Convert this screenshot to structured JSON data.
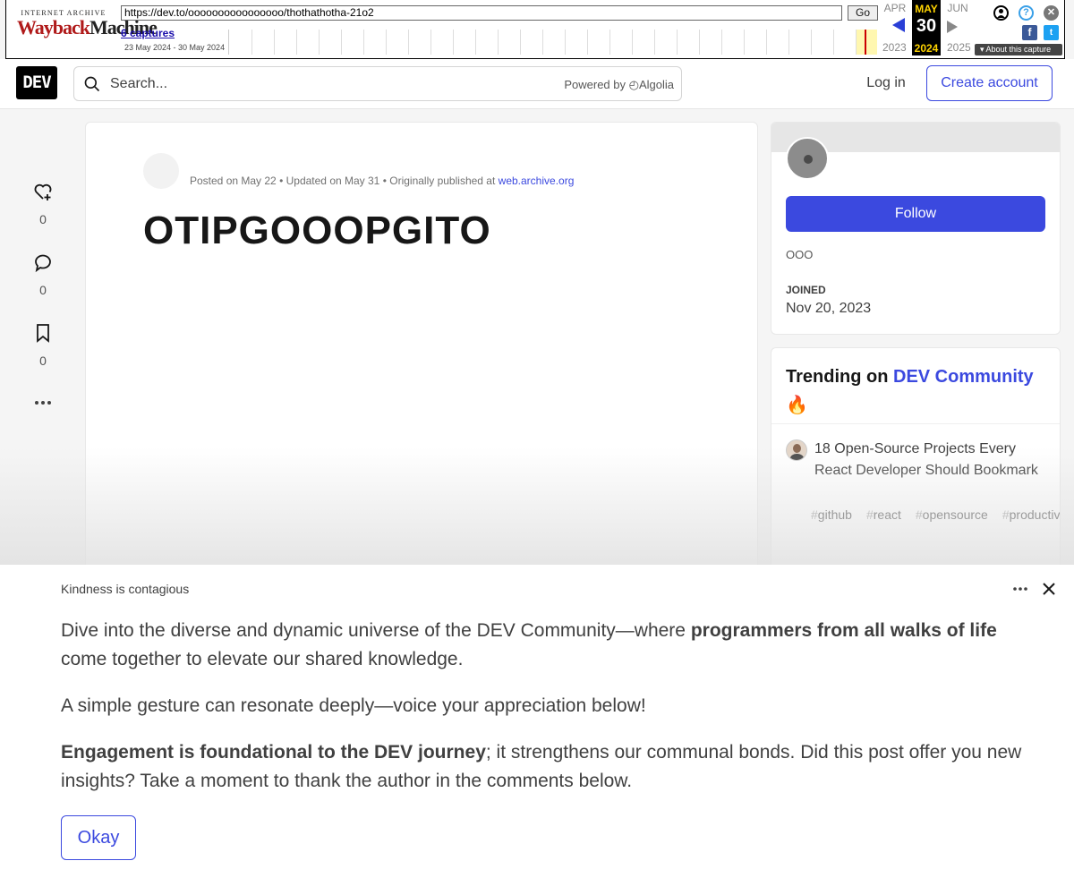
{
  "wayback": {
    "logo_top": "INTERNET ARCHIVE",
    "logo_wayback": "WaybackMachine",
    "url": "https://dev.to/oooooooooooooooo/thothathotha-21o2",
    "go_label": "Go",
    "captures_label": "6 captures",
    "date_range": "23 May 2024 - 30 May 2024",
    "prev_month": "APR",
    "cur_month": "MAY",
    "cur_day": "30",
    "cur_year": "2024",
    "next_month": "JUN",
    "prev_year": "2023",
    "next_year": "2025",
    "about_label": "About this capture"
  },
  "header": {
    "logo": "DEV",
    "search_placeholder": "Search...",
    "powered_by": "Powered by",
    "powered_brand": "Algolia",
    "login_label": "Log in",
    "create_account_label": "Create account"
  },
  "actions": {
    "reactions": "0",
    "comments": "0",
    "bookmarks": "0"
  },
  "article": {
    "author": "",
    "posted": "Posted on May 22",
    "updated": "Updated on May 31",
    "originally": "Originally published at",
    "origin_link": "web.archive.org",
    "title": "OTIPGOOOPGITO",
    "body_lines": [
      "",
      "",
      "",
      "",
      "",
      "",
      "",
      "",
      "",
      ""
    ]
  },
  "profile": {
    "name": "",
    "follow_label": "Follow",
    "bio": "OOO",
    "joined_label": "JOINED",
    "joined_value": "Nov 20, 2023"
  },
  "trending": {
    "heading_prefix": "Trending on",
    "heading_community": "DEV Community",
    "heading_emoji": "🔥",
    "item_title": "18 Open-Source Projects Every React Developer Should Bookmark ",
    "tags": [
      "github",
      "react",
      "opensource",
      "productivity"
    ]
  },
  "modal": {
    "badge": " Kindness is contagious",
    "p1_start": "Dive into the diverse and dynamic universe of the DEV Community—where ",
    "p1_bold": "programmers from all walks of life",
    "p1_end": " come together to elevate our shared knowledge.",
    "p2": "A simple gesture can resonate deeply—voice your appreciation below!",
    "p3_bold": "Engagement is foundational to the DEV journey",
    "p3_end": "; it strengthens our communal bonds. Did this post offer you new insights? Take a moment to thank the author in the comments below.",
    "okay_label": "Okay"
  },
  "colors": {
    "accent": "#3b49df",
    "wayback_red": "#b01a1a",
    "wayback_highlight": "#ffd400"
  }
}
